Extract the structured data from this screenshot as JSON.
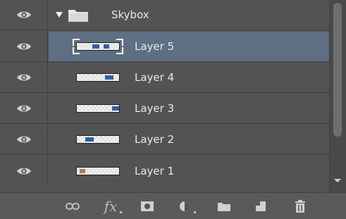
{
  "layers_panel": {
    "group": {
      "name": "Skybox",
      "expanded": true
    },
    "layers": [
      {
        "name": "Layer 5",
        "selected": true
      },
      {
        "name": "Layer 4",
        "selected": false
      },
      {
        "name": "Layer 3",
        "selected": false
      },
      {
        "name": "Layer 2",
        "selected": false
      },
      {
        "name": "Layer 1",
        "selected": false
      }
    ],
    "toolbar_icons": [
      "link-icon",
      "fx-icon",
      "mask-icon",
      "adjustment-icon",
      "folder-icon",
      "new-layer-icon",
      "trash-icon"
    ],
    "fx_label": "fx",
    "colors": {
      "panel": "#535353",
      "selected_row": "#5f6f83",
      "divider": "#3f3f3f",
      "text": "#e8e8e8"
    }
  }
}
